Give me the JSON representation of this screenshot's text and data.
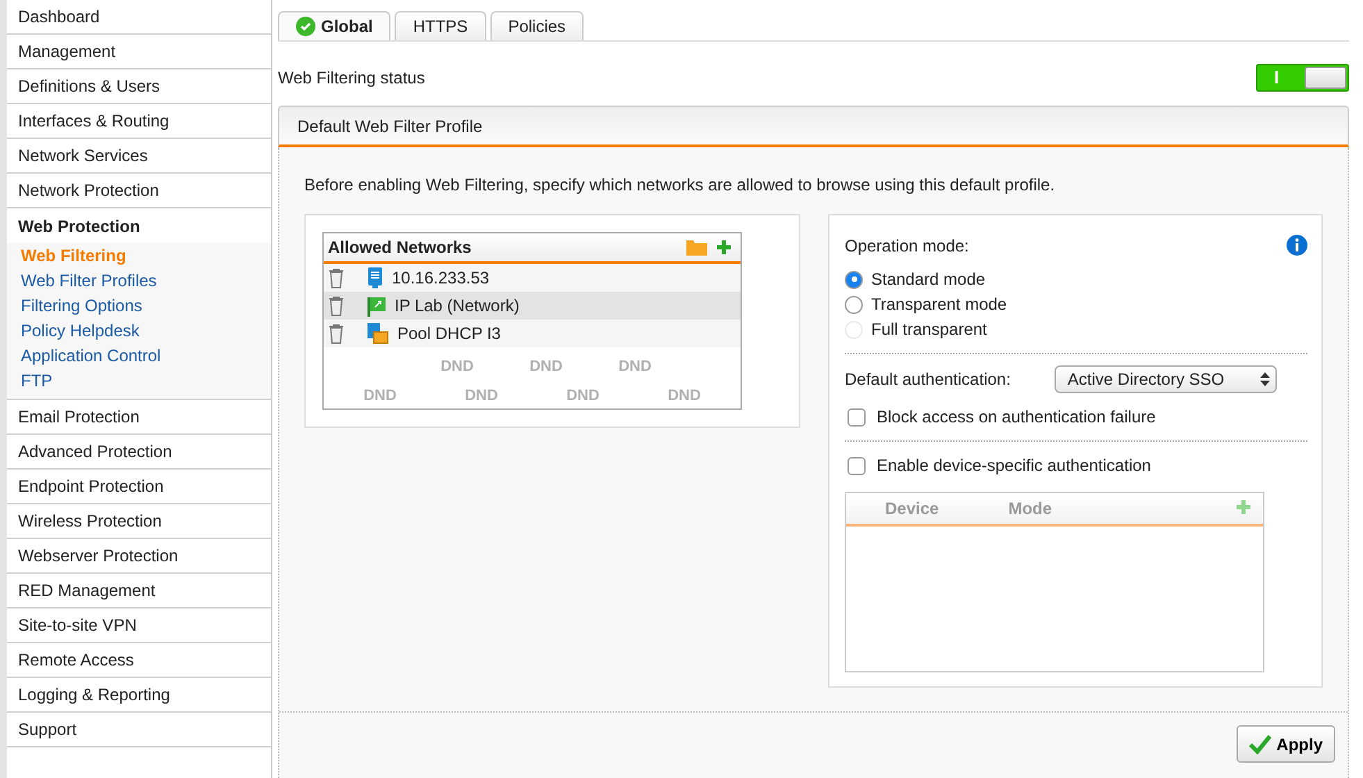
{
  "sidebar": {
    "items": [
      {
        "label": "Dashboard",
        "expanded": false
      },
      {
        "label": "Management",
        "expanded": false
      },
      {
        "label": "Definitions & Users",
        "expanded": false
      },
      {
        "label": "Interfaces & Routing",
        "expanded": false
      },
      {
        "label": "Network Services",
        "expanded": false
      },
      {
        "label": "Network Protection",
        "expanded": false
      },
      {
        "label": "Web Protection",
        "expanded": true,
        "children": [
          {
            "label": "Web Filtering",
            "selected": true
          },
          {
            "label": "Web Filter Profiles",
            "selected": false
          },
          {
            "label": "Filtering Options",
            "selected": false
          },
          {
            "label": "Policy Helpdesk",
            "selected": false
          },
          {
            "label": "Application Control",
            "selected": false
          },
          {
            "label": "FTP",
            "selected": false
          }
        ]
      },
      {
        "label": "Email Protection",
        "expanded": false
      },
      {
        "label": "Advanced Protection",
        "expanded": false
      },
      {
        "label": "Endpoint Protection",
        "expanded": false
      },
      {
        "label": "Wireless Protection",
        "expanded": false
      },
      {
        "label": "Webserver Protection",
        "expanded": false
      },
      {
        "label": "RED Management",
        "expanded": false
      },
      {
        "label": "Site-to-site VPN",
        "expanded": false
      },
      {
        "label": "Remote Access",
        "expanded": false
      },
      {
        "label": "Logging & Reporting",
        "expanded": false
      },
      {
        "label": "Support",
        "expanded": false
      }
    ]
  },
  "tabs": [
    {
      "label": "Global",
      "selected": true
    },
    {
      "label": "HTTPS",
      "selected": false
    },
    {
      "label": "Policies",
      "selected": false
    }
  ],
  "status": {
    "label": "Web Filtering status",
    "on": true,
    "on_glyph": "I"
  },
  "panel": {
    "title": "Default Web Filter Profile",
    "description": "Before enabling Web Filtering, specify which networks are allowed to browse using this default profile.",
    "allowed_networks": {
      "title": "Allowed Networks",
      "rows": [
        {
          "label": "10.16.233.53",
          "kind": "host",
          "selected": false
        },
        {
          "label": "IP Lab (Network)",
          "kind": "network",
          "selected": true
        },
        {
          "label": "Pool DHCP I3",
          "kind": "pool",
          "selected": false
        }
      ],
      "drop_marks": [
        "DND",
        "DND",
        "DND",
        "DND",
        "DND",
        "DND",
        "DND"
      ]
    },
    "operation_mode": {
      "label": "Operation mode:",
      "options": [
        {
          "label": "Standard mode",
          "selected": true,
          "disabled": false
        },
        {
          "label": "Transparent mode",
          "selected": false,
          "disabled": false
        },
        {
          "label": "Full transparent",
          "selected": false,
          "disabled": true
        }
      ]
    },
    "default_authentication": {
      "label": "Default authentication:",
      "value": "Active Directory SSO"
    },
    "checkboxes": [
      {
        "label": "Block access on authentication failure",
        "checked": false
      },
      {
        "label": "Enable device-specific authentication",
        "checked": false
      }
    ],
    "device_table": {
      "columns": [
        "Device",
        "Mode"
      ],
      "disabled": true
    }
  },
  "buttons": [
    {
      "label": "Apply"
    }
  ]
}
